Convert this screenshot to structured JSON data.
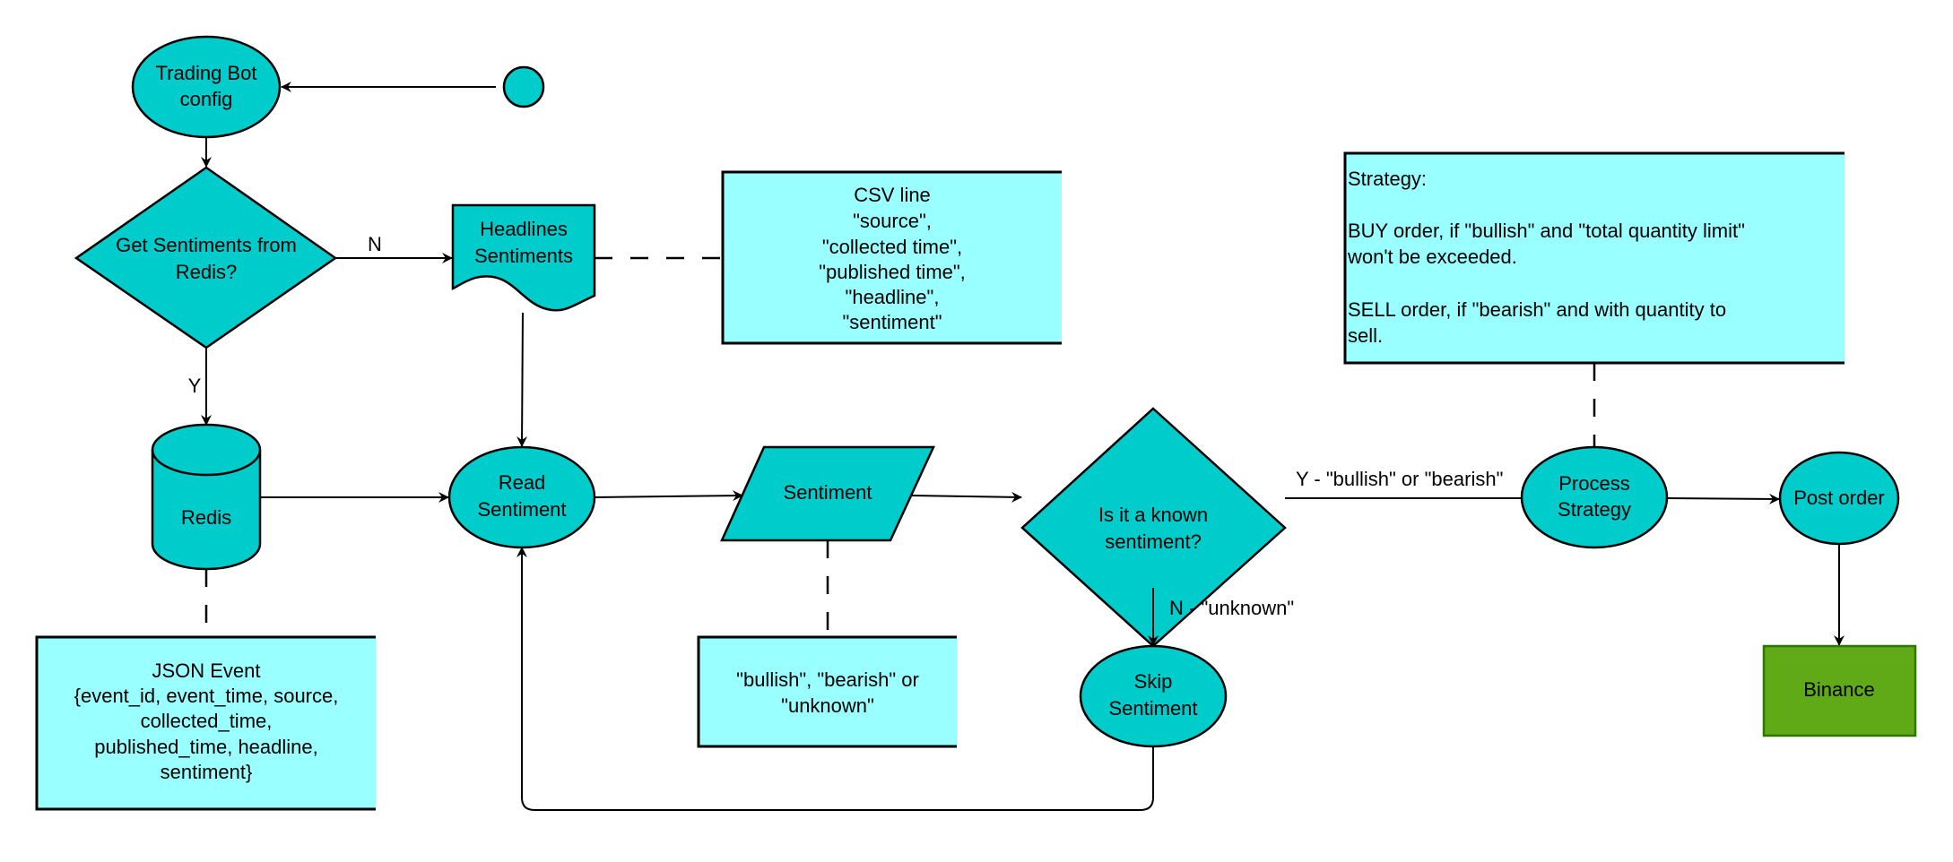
{
  "diagram": {
    "colors": {
      "process_fill": "#00cccc",
      "note_fill": "#99ffff",
      "external_fill": "#60a917",
      "external_stroke": "#2d7600",
      "stroke": "#000000"
    },
    "nodes": {
      "start": {
        "label": ""
      },
      "trading_bot_config": {
        "lines": [
          "Trading Bot",
          "config"
        ]
      },
      "get_sentiments_decision": {
        "lines": [
          "Get Sentiments from",
          "Redis?"
        ]
      },
      "headlines_sentiments": {
        "lines": [
          "Headlines",
          "Sentiments"
        ]
      },
      "redis": {
        "label": "Redis"
      },
      "read_sentiment": {
        "lines": [
          "Read",
          "Sentiment"
        ]
      },
      "sentiment": {
        "label": "Sentiment"
      },
      "known_sentiment_decision": {
        "lines": [
          "Is it a known",
          "sentiment?"
        ]
      },
      "process_strategy": {
        "lines": [
          "Process",
          "Strategy"
        ]
      },
      "post_order": {
        "label": "Post order"
      },
      "binance": {
        "label": "Binance"
      },
      "skip_sentiment": {
        "lines": [
          "Skip",
          "Sentiment"
        ]
      }
    },
    "notes": {
      "csv_line": {
        "lines": [
          "CSV line",
          "\"source\",",
          "\"collected time\",",
          "\"published time\",",
          "\"headline\",",
          "\"sentiment\""
        ]
      },
      "strategy": {
        "lines": [
          "Strategy:",
          "",
          "BUY order, if \"bullish\" and \"total quantity limit\"",
          "won't be exceeded.",
          "",
          "SELL order, if \"bearish\" and with quantity to",
          "sell."
        ]
      },
      "json_event": {
        "lines": [
          "JSON Event",
          "{event_id, event_time, source,",
          "collected_time,",
          "published_time, headline,",
          "sentiment}"
        ]
      },
      "sentiment_values": {
        "lines": [
          "\"bullish\", \"bearish\" or",
          "\"unknown\""
        ]
      }
    },
    "edge_labels": {
      "no_redis": "N",
      "yes_redis": "Y",
      "known_yes": "Y - \"bullish\" or \"bearish\"",
      "known_no": "N - \"unknown\""
    }
  }
}
